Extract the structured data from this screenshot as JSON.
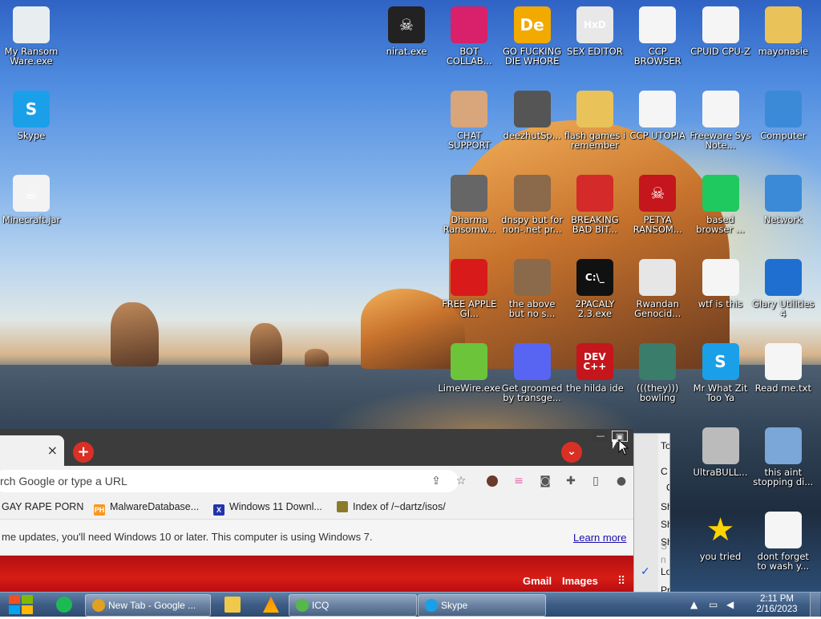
{
  "desktop": {
    "icons": [
      {
        "label": "My Ransom Ware.exe",
        "glyph": "",
        "color": "#e8eef0"
      },
      {
        "label": "Skype",
        "glyph": "S",
        "color": "#1aa0e8"
      },
      {
        "label": "Minecraft.jar",
        "glyph": "☕",
        "color": "#f3f3f3"
      },
      {
        "label": "nirat.exe",
        "glyph": "☠",
        "color": "#222222"
      },
      {
        "label": "BOT COLLAB...",
        "glyph": "",
        "color": "#d8206b"
      },
      {
        "label": "GO FUCKING DIE WHORE",
        "glyph": "De",
        "color": "#f2a900"
      },
      {
        "label": "SEX EDITOR",
        "glyph": "HxD",
        "color": "#e8e8e8"
      },
      {
        "label": "CCP BROWSER",
        "glyph": "",
        "color": "#f5f5f5"
      },
      {
        "label": "CPUID CPU-Z",
        "glyph": "",
        "color": "#f5f5f5"
      },
      {
        "label": "mayonasie",
        "glyph": "",
        "color": "#e9c35a"
      },
      {
        "label": "CHAT SUPPORT",
        "glyph": "",
        "color": "#d9a57a"
      },
      {
        "label": "deezhutSp...",
        "glyph": "",
        "color": "#555555"
      },
      {
        "label": "flash games i remember",
        "glyph": "",
        "color": "#e9c35a"
      },
      {
        "label": "CCP UTOPIA",
        "glyph": "",
        "color": "#f5f5f5"
      },
      {
        "label": "Freeware Sys Note...",
        "glyph": "",
        "color": "#f5f5f5"
      },
      {
        "label": "Computer",
        "glyph": "",
        "color": "#3b8ad8"
      },
      {
        "label": "Dharma Ransomw...",
        "glyph": "",
        "color": "#666666"
      },
      {
        "label": "dnspy but for non-.net pr...",
        "glyph": "",
        "color": "#8a6a4a"
      },
      {
        "label": "BREAKING BAD BIT...",
        "glyph": "",
        "color": "#d42a2a"
      },
      {
        "label": "PETYA RANSOM...",
        "glyph": "☠",
        "color": "#c4161c"
      },
      {
        "label": "based browser ...",
        "glyph": "",
        "color": "#20c860"
      },
      {
        "label": "Network",
        "glyph": "",
        "color": "#3b8ad8"
      },
      {
        "label": "FREE APPLE GI...",
        "glyph": "",
        "color": "#d91a1a"
      },
      {
        "label": "the above but no s...",
        "glyph": "",
        "color": "#8a6a4a"
      },
      {
        "label": "2PACALY 2.3.exe",
        "glyph": "C:\\_",
        "color": "#111111"
      },
      {
        "label": "Rwandan Genocid...",
        "glyph": "",
        "color": "#e6e6e6"
      },
      {
        "label": "wtf is this",
        "glyph": "",
        "color": "#f5f5f5"
      },
      {
        "label": "Glary Utilities 4",
        "glyph": "",
        "color": "#1e6fd0"
      },
      {
        "label": "LimeWire.exe",
        "glyph": "",
        "color": "#6cc43a"
      },
      {
        "label": "Get groomed by transge...",
        "glyph": "",
        "color": "#5865f2"
      },
      {
        "label": "the hilda ide",
        "glyph": "DEV C++",
        "color": "#c4161c"
      },
      {
        "label": "(((they))) bowling",
        "glyph": "",
        "color": "#3a7d6a"
      },
      {
        "label": "Mr What Zit Too Ya",
        "glyph": "S",
        "color": "#1aa0e8"
      },
      {
        "label": "Read me.txt",
        "glyph": "",
        "color": "#f5f5f5"
      },
      {
        "label": "UltraBULL...",
        "glyph": "",
        "color": "#bbbbbb"
      },
      {
        "label": "this aint stopping di...",
        "glyph": "",
        "color": "#7aa6d8"
      },
      {
        "label": "you tried",
        "glyph": "★",
        "color": "rgba(0,0,0,0)"
      },
      {
        "label": "dont forget to wash y...",
        "glyph": "",
        "color": "#f5f5f5"
      }
    ]
  },
  "browser": {
    "tab_close": "×",
    "new_tab_plus": "+",
    "dropdown": "⌄",
    "omnibox_placeholder": "rch Google or type a URL",
    "bookmarks": [
      {
        "label": "GAY RAPE PORN",
        "fav": "",
        "color": ""
      },
      {
        "label": "MalwareDatabase...",
        "fav": "PH",
        "color": "#f7971d"
      },
      {
        "label": "Windows 11 Downl...",
        "fav": "X",
        "color": "#2233aa"
      },
      {
        "label": "Index of /~dartz/isos/",
        "fav": "",
        "color": "#8a7a2a"
      }
    ],
    "infobar_message": "me updates, you'll need Windows 10 or later. This computer is using Windows 7.",
    "infobar_link": "Learn more",
    "ntp_links": [
      "Gmail",
      "Images"
    ]
  },
  "window_controls": {
    "minimize": "—",
    "restore": "▣"
  },
  "context_menu": {
    "items": [
      "To",
      "C",
      "OX",
      "Sh",
      "Sh",
      "Sh",
      "S",
      "n",
      "Lo",
      "Pr"
    ]
  },
  "taskbar": {
    "buttons": [
      {
        "label": "New Tab - Google ...",
        "color": "#e0a020"
      },
      {
        "label": "ICQ",
        "color": "#55b84a"
      },
      {
        "label": "Skype",
        "color": "#1aa0e8"
      }
    ],
    "clock_time": "2:11 PM",
    "clock_date": "2/16/2023"
  }
}
